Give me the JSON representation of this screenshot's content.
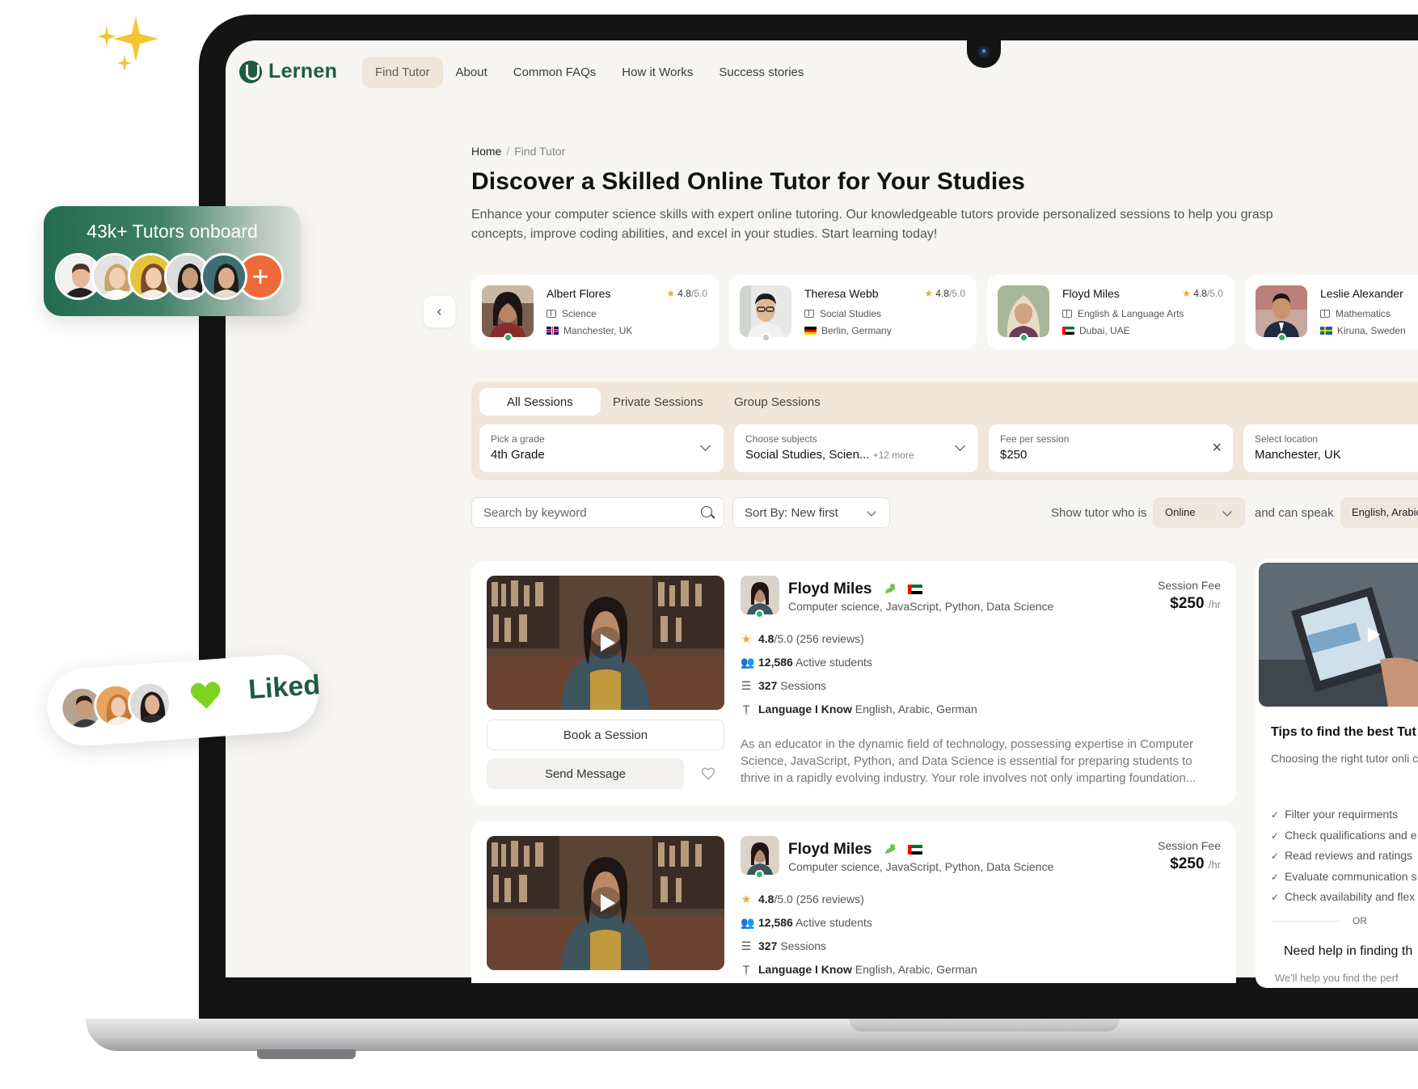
{
  "brand": {
    "name": "Lernen",
    "accent": "#1e5b43"
  },
  "nav": {
    "items": [
      "Find Tutor",
      "About",
      "Common FAQs",
      "How it Works",
      "Success stories"
    ],
    "active": "Find Tutor"
  },
  "breadcrumb": {
    "home": "Home",
    "current": "Find Tutor"
  },
  "hero": {
    "title": "Discover a Skilled Online Tutor for Your Studies",
    "intro": "Enhance your computer science skills with expert online tutoring. Our knowledgeable tutors provide personalized sessions to help you grasp concepts, improve coding abilities, and excel in your studies. Start learning today!"
  },
  "featured_tutors": [
    {
      "name": "Albert Flores",
      "rating": "4.8",
      "rating_max": "/5.0",
      "subject": "Science",
      "location": "Manchester, UK",
      "online": true
    },
    {
      "name": "Theresa Webb",
      "rating": "4.8",
      "rating_max": "/5.0",
      "subject": "Social Studies",
      "location": "Berlin, Germany",
      "online": false
    },
    {
      "name": "Floyd Miles",
      "rating": "4.8",
      "rating_max": "/5.0",
      "subject": "English & Language Arts",
      "location": "Dubai, UAE",
      "online": true
    },
    {
      "name": "Leslie Alexander",
      "rating": "4.8",
      "rating_max": "/5.0",
      "subject": "Mathematics",
      "location": "Kiruna, Sweden",
      "online": true
    }
  ],
  "session_tabs": [
    "All Sessions",
    "Private Sessions",
    "Group Sessions"
  ],
  "filters": {
    "grade": {
      "label": "Pick a grade",
      "value": "4th Grade"
    },
    "subjects": {
      "label": "Choose subjects",
      "value": "Social Studies, Scien...",
      "more": "+12 more"
    },
    "fee": {
      "label": "Fee per session",
      "value": "$250"
    },
    "location": {
      "label": "Select location",
      "value": "Manchester, UK"
    },
    "search_placeholder": "Search by keyword",
    "sort": "Sort By: New first",
    "show_label": "Show tutor who is",
    "status": "Online",
    "speak_label": "and can speak",
    "languages": "English, Arabic"
  },
  "listings": [
    {
      "name": "Floyd Miles",
      "subjects": "Computer science, JavaScript, Python, Data Science",
      "fee_label": "Session Fee",
      "fee": "$250",
      "fee_unit": "/hr",
      "rating": "4.8",
      "rating_rest": "/5.0 (256 reviews)",
      "students": "12,586",
      "students_label": "Active students",
      "sessions": "327",
      "sessions_label": "Sessions",
      "lang_label": "Language I Know",
      "languages": "English, Arabic, German",
      "description": "As an educator in the dynamic field of technology, possessing expertise in Computer Science, JavaScript, Python, and Data Science is essential for preparing students to thrive in a rapidly evolving industry. Your role involves not only imparting foundation...",
      "book_label": "Book a Session",
      "message_label": "Send Message"
    },
    {
      "name": "Floyd Miles",
      "subjects": "Computer science, JavaScript, Python, Data Science",
      "fee_label": "Session Fee",
      "fee": "$250",
      "fee_unit": "/hr",
      "rating": "4.8",
      "rating_rest": "/5.0 (256 reviews)",
      "students": "12,586",
      "students_label": "Active students",
      "sessions": "327",
      "sessions_label": "Sessions",
      "lang_label": "Language I Know",
      "languages": "English, Arabic, German"
    }
  ],
  "tips": {
    "title": "Tips to find the best Tut",
    "body": "Choosing the right tutor onli careful consideration. Here a help you make an informed c",
    "items": [
      "Filter your requirments",
      "Check qualifications and e",
      "Read reviews and ratings",
      "Evaluate communication s",
      "Check availability and flex"
    ],
    "or": "OR",
    "help_title": "Need help in finding th",
    "help_sub": "We'll help you find the perf"
  },
  "promo": {
    "tutors_onboard": "43k+ Tutors onboard",
    "liked": "Liked"
  },
  "icons": [
    "logo-icon",
    "chevron-left-icon",
    "chevron-down-icon",
    "close-icon",
    "search-icon",
    "star-icon",
    "book-icon",
    "users-icon",
    "list-icon",
    "translate-icon",
    "play-icon",
    "heart-icon",
    "plus-icon",
    "sparkle-icon",
    "verified-icon"
  ]
}
